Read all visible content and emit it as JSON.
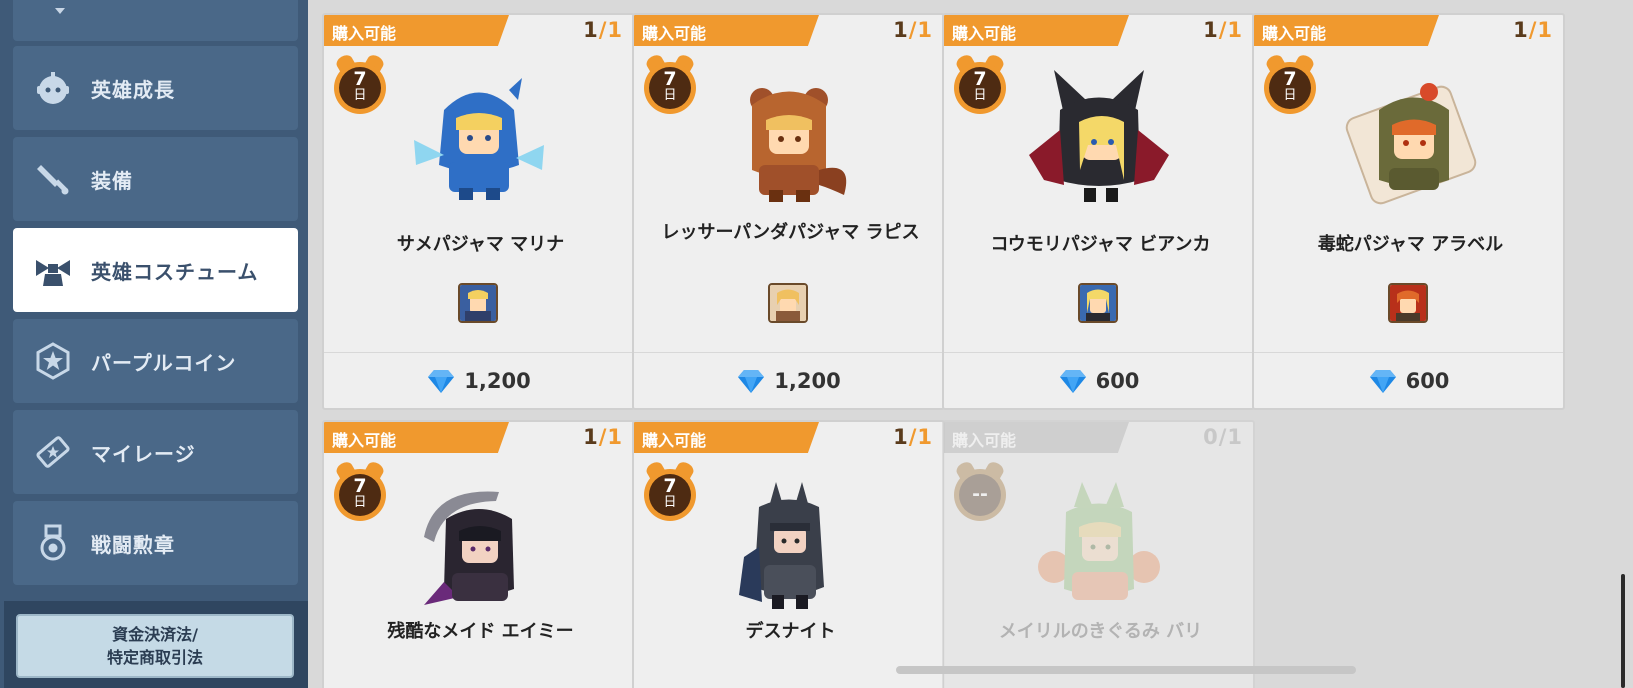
{
  "sidebar": {
    "items": [
      {
        "label": "英雄成長",
        "icon": "robot-face-icon"
      },
      {
        "label": "装備",
        "icon": "sword-icon"
      },
      {
        "label": "英雄コスチューム",
        "icon": "costume-bow-icon"
      },
      {
        "label": "パープルコイン",
        "icon": "hexagon-star-coin-icon"
      },
      {
        "label": "マイレージ",
        "icon": "ticket-star-icon"
      },
      {
        "label": "戦闘勲章",
        "icon": "medal-icon"
      }
    ],
    "active_index": 2,
    "legal_button": "資金決済法/\n特定商取引法"
  },
  "cards": [
    {
      "ribbon": "購入可能",
      "count_left": "1",
      "count_sep": "/",
      "count_right": "1",
      "timer_days": "7",
      "timer_unit": "日",
      "name": "サメパジャマ マリナ",
      "price": "1,200",
      "available": true
    },
    {
      "ribbon": "購入可能",
      "count_left": "1",
      "count_sep": "/",
      "count_right": "1",
      "timer_days": "7",
      "timer_unit": "日",
      "name": "レッサーパンダパジャマ ラピス",
      "price": "1,200",
      "available": true
    },
    {
      "ribbon": "購入可能",
      "count_left": "1",
      "count_sep": "/",
      "count_right": "1",
      "timer_days": "7",
      "timer_unit": "日",
      "name": "コウモリパジャマ ビアンカ",
      "price": "600",
      "available": true
    },
    {
      "ribbon": "購入可能",
      "count_left": "1",
      "count_sep": "/",
      "count_right": "1",
      "timer_days": "7",
      "timer_unit": "日",
      "name": "毒蛇パジャマ アラベル",
      "price": "600",
      "available": true
    },
    {
      "ribbon": "購入可能",
      "count_left": "1",
      "count_sep": "/",
      "count_right": "1",
      "timer_days": "7",
      "timer_unit": "日",
      "name": "残酷なメイド エイミー",
      "available": true
    },
    {
      "ribbon": "購入可能",
      "count_left": "1",
      "count_sep": "/",
      "count_right": "1",
      "timer_days": "7",
      "timer_unit": "日",
      "name": "デスナイト",
      "available": true
    },
    {
      "ribbon": "購入可能",
      "count_left": "0",
      "count_sep": "/",
      "count_right": "1",
      "timer_days": "--",
      "timer_unit": "",
      "name": "メイリルのきぐるみ バリ",
      "available": false
    }
  ],
  "colors": {
    "sidebar_bg": "#3f5a78",
    "sidebar_item": "#4a6888",
    "accent_orange": "#f0992e",
    "gem_blue": "#1e88e5"
  }
}
